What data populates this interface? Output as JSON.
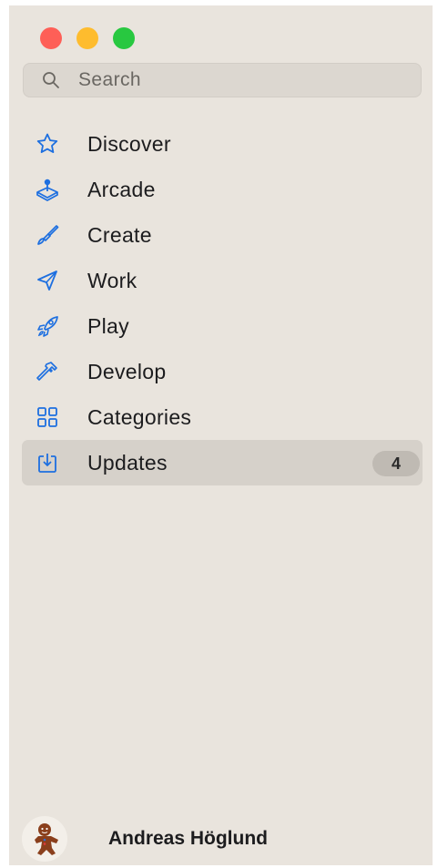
{
  "window": {
    "traffic_lights": {
      "close_color": "#fe5f57",
      "minimize_color": "#febc2e",
      "zoom_color": "#28c840"
    }
  },
  "search": {
    "placeholder": "Search",
    "icon": "search-icon"
  },
  "sidebar": {
    "accent_color": "#1d6fe0",
    "items": [
      {
        "label": "Discover",
        "icon": "star-icon",
        "selected": false
      },
      {
        "label": "Arcade",
        "icon": "joystick-icon",
        "selected": false
      },
      {
        "label": "Create",
        "icon": "paintbrush-icon",
        "selected": false
      },
      {
        "label": "Work",
        "icon": "paper-plane-icon",
        "selected": false
      },
      {
        "label": "Play",
        "icon": "rocket-icon",
        "selected": false
      },
      {
        "label": "Develop",
        "icon": "hammer-icon",
        "selected": false
      },
      {
        "label": "Categories",
        "icon": "grid-icon",
        "selected": false
      },
      {
        "label": "Updates",
        "icon": "download-tray-icon",
        "selected": true,
        "badge": "4"
      }
    ]
  },
  "account": {
    "name": "Andreas Höglund",
    "avatar_icon": "gingerbread-avatar"
  }
}
